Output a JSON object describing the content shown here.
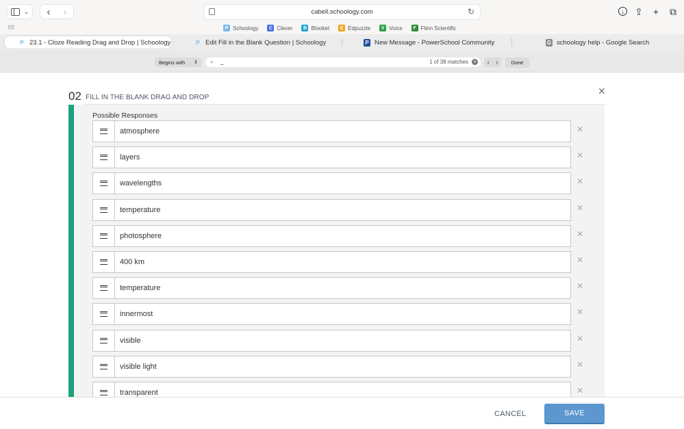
{
  "browser": {
    "url": "cabell.schoology.com",
    "favorites": [
      {
        "label": "Schoology",
        "icon": "P",
        "color": "#7ab8e8"
      },
      {
        "label": "Clever",
        "icon": "C",
        "color": "#4a6ee0"
      },
      {
        "label": "Blooket",
        "icon": "B",
        "color": "#1fa5cf"
      },
      {
        "label": "Edpuzzle",
        "icon": "E",
        "color": "#f0a21d"
      },
      {
        "label": "Voice",
        "icon": "V",
        "color": "#2b9f4a"
      },
      {
        "label": "Flinn Scientific",
        "icon": "F",
        "color": "#2e8b3a"
      }
    ],
    "tabs": [
      {
        "label": "23.1 - Cloze Reading Drag and Drop | Schoology",
        "icon": "P"
      },
      {
        "label": "Edit Fill in the Blank Question | Schoology",
        "icon": "P"
      },
      {
        "label": "New Message - PowerSchool Community",
        "icon": "P"
      },
      {
        "label": "schoology help - Google Search",
        "icon": "G"
      }
    ],
    "find": {
      "mode": "Begins with",
      "query": "_",
      "matches": "1 of 38 matches",
      "done_label": "Done"
    }
  },
  "question": {
    "number": "02",
    "type_label": "FILL IN THE BLANK DRAG AND DROP",
    "responses_label": "Possible Responses",
    "responses": [
      "atmosphere",
      "layers",
      "wavelengths",
      "temperature",
      "photosphere",
      "400 km",
      "temperature",
      "innermost",
      "visible",
      "visible light",
      "transparent"
    ]
  },
  "footer": {
    "cancel_label": "CANCEL",
    "save_label": "SAVE"
  },
  "colors": {
    "accent": "#1aa37d",
    "save_button": "#5c97cf"
  }
}
